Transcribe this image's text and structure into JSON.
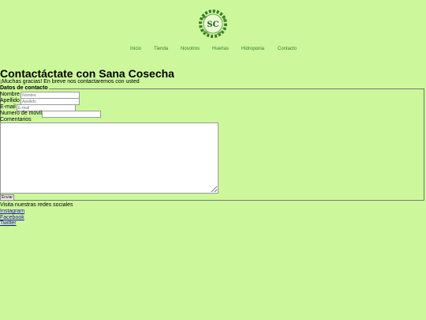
{
  "logo": {
    "initials": "SC"
  },
  "nav": [
    "Inicio",
    "Tienda",
    "Nosotros",
    "Huertas",
    "Hidroponia",
    "Contacto"
  ],
  "page_title": "Contactáctate con Sana Cosecha",
  "thanks_message": "¡Muchas gracias! En breve nos contactaremos con usted",
  "form": {
    "legend": "Datos de contacto",
    "fields": [
      {
        "label": "Nombre",
        "placeholder": "Nombre"
      },
      {
        "label": "Apellido",
        "placeholder": "Apellido"
      },
      {
        "label": "E-mail",
        "placeholder": "E-mail"
      },
      {
        "label": "Numero de movil",
        "placeholder": ""
      }
    ],
    "comments_label": "Comentarios",
    "submit_label": "Enviar"
  },
  "social": {
    "title": "Visita nuestras redes sociales",
    "links": [
      "Instagram",
      "Facebook",
      "Twitter"
    ]
  },
  "colors": {
    "background": "#ccf89b",
    "nav_link": "#2e7d32",
    "link": "#1a0dab"
  }
}
